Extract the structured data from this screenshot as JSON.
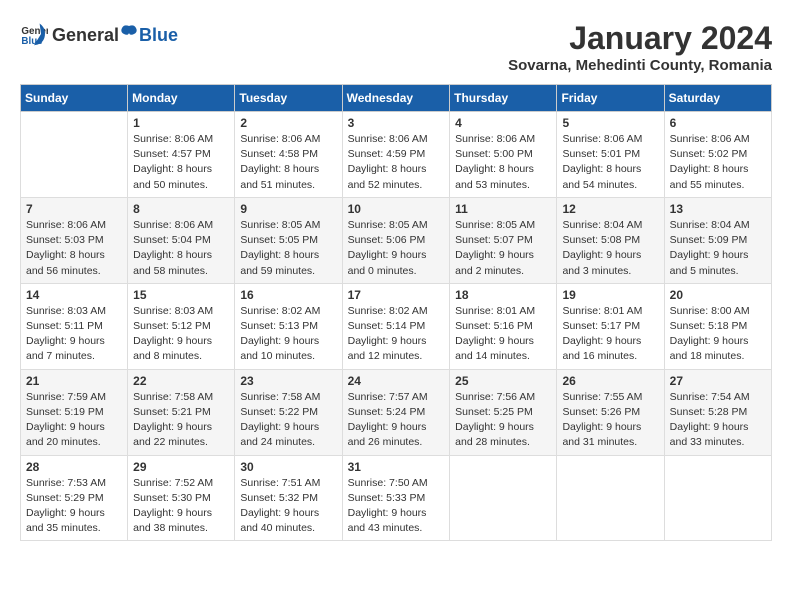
{
  "header": {
    "logo_general": "General",
    "logo_blue": "Blue",
    "month": "January 2024",
    "location": "Sovarna, Mehedinti County, Romania"
  },
  "weekdays": [
    "Sunday",
    "Monday",
    "Tuesday",
    "Wednesday",
    "Thursday",
    "Friday",
    "Saturday"
  ],
  "weeks": [
    [
      {
        "day": "",
        "info": ""
      },
      {
        "day": "1",
        "info": "Sunrise: 8:06 AM\nSunset: 4:57 PM\nDaylight: 8 hours\nand 50 minutes."
      },
      {
        "day": "2",
        "info": "Sunrise: 8:06 AM\nSunset: 4:58 PM\nDaylight: 8 hours\nand 51 minutes."
      },
      {
        "day": "3",
        "info": "Sunrise: 8:06 AM\nSunset: 4:59 PM\nDaylight: 8 hours\nand 52 minutes."
      },
      {
        "day": "4",
        "info": "Sunrise: 8:06 AM\nSunset: 5:00 PM\nDaylight: 8 hours\nand 53 minutes."
      },
      {
        "day": "5",
        "info": "Sunrise: 8:06 AM\nSunset: 5:01 PM\nDaylight: 8 hours\nand 54 minutes."
      },
      {
        "day": "6",
        "info": "Sunrise: 8:06 AM\nSunset: 5:02 PM\nDaylight: 8 hours\nand 55 minutes."
      }
    ],
    [
      {
        "day": "7",
        "info": "Sunrise: 8:06 AM\nSunset: 5:03 PM\nDaylight: 8 hours\nand 56 minutes."
      },
      {
        "day": "8",
        "info": "Sunrise: 8:06 AM\nSunset: 5:04 PM\nDaylight: 8 hours\nand 58 minutes."
      },
      {
        "day": "9",
        "info": "Sunrise: 8:05 AM\nSunset: 5:05 PM\nDaylight: 8 hours\nand 59 minutes."
      },
      {
        "day": "10",
        "info": "Sunrise: 8:05 AM\nSunset: 5:06 PM\nDaylight: 9 hours\nand 0 minutes."
      },
      {
        "day": "11",
        "info": "Sunrise: 8:05 AM\nSunset: 5:07 PM\nDaylight: 9 hours\nand 2 minutes."
      },
      {
        "day": "12",
        "info": "Sunrise: 8:04 AM\nSunset: 5:08 PM\nDaylight: 9 hours\nand 3 minutes."
      },
      {
        "day": "13",
        "info": "Sunrise: 8:04 AM\nSunset: 5:09 PM\nDaylight: 9 hours\nand 5 minutes."
      }
    ],
    [
      {
        "day": "14",
        "info": "Sunrise: 8:03 AM\nSunset: 5:11 PM\nDaylight: 9 hours\nand 7 minutes."
      },
      {
        "day": "15",
        "info": "Sunrise: 8:03 AM\nSunset: 5:12 PM\nDaylight: 9 hours\nand 8 minutes."
      },
      {
        "day": "16",
        "info": "Sunrise: 8:02 AM\nSunset: 5:13 PM\nDaylight: 9 hours\nand 10 minutes."
      },
      {
        "day": "17",
        "info": "Sunrise: 8:02 AM\nSunset: 5:14 PM\nDaylight: 9 hours\nand 12 minutes."
      },
      {
        "day": "18",
        "info": "Sunrise: 8:01 AM\nSunset: 5:16 PM\nDaylight: 9 hours\nand 14 minutes."
      },
      {
        "day": "19",
        "info": "Sunrise: 8:01 AM\nSunset: 5:17 PM\nDaylight: 9 hours\nand 16 minutes."
      },
      {
        "day": "20",
        "info": "Sunrise: 8:00 AM\nSunset: 5:18 PM\nDaylight: 9 hours\nand 18 minutes."
      }
    ],
    [
      {
        "day": "21",
        "info": "Sunrise: 7:59 AM\nSunset: 5:19 PM\nDaylight: 9 hours\nand 20 minutes."
      },
      {
        "day": "22",
        "info": "Sunrise: 7:58 AM\nSunset: 5:21 PM\nDaylight: 9 hours\nand 22 minutes."
      },
      {
        "day": "23",
        "info": "Sunrise: 7:58 AM\nSunset: 5:22 PM\nDaylight: 9 hours\nand 24 minutes."
      },
      {
        "day": "24",
        "info": "Sunrise: 7:57 AM\nSunset: 5:24 PM\nDaylight: 9 hours\nand 26 minutes."
      },
      {
        "day": "25",
        "info": "Sunrise: 7:56 AM\nSunset: 5:25 PM\nDaylight: 9 hours\nand 28 minutes."
      },
      {
        "day": "26",
        "info": "Sunrise: 7:55 AM\nSunset: 5:26 PM\nDaylight: 9 hours\nand 31 minutes."
      },
      {
        "day": "27",
        "info": "Sunrise: 7:54 AM\nSunset: 5:28 PM\nDaylight: 9 hours\nand 33 minutes."
      }
    ],
    [
      {
        "day": "28",
        "info": "Sunrise: 7:53 AM\nSunset: 5:29 PM\nDaylight: 9 hours\nand 35 minutes."
      },
      {
        "day": "29",
        "info": "Sunrise: 7:52 AM\nSunset: 5:30 PM\nDaylight: 9 hours\nand 38 minutes."
      },
      {
        "day": "30",
        "info": "Sunrise: 7:51 AM\nSunset: 5:32 PM\nDaylight: 9 hours\nand 40 minutes."
      },
      {
        "day": "31",
        "info": "Sunrise: 7:50 AM\nSunset: 5:33 PM\nDaylight: 9 hours\nand 43 minutes."
      },
      {
        "day": "",
        "info": ""
      },
      {
        "day": "",
        "info": ""
      },
      {
        "day": "",
        "info": ""
      }
    ]
  ]
}
